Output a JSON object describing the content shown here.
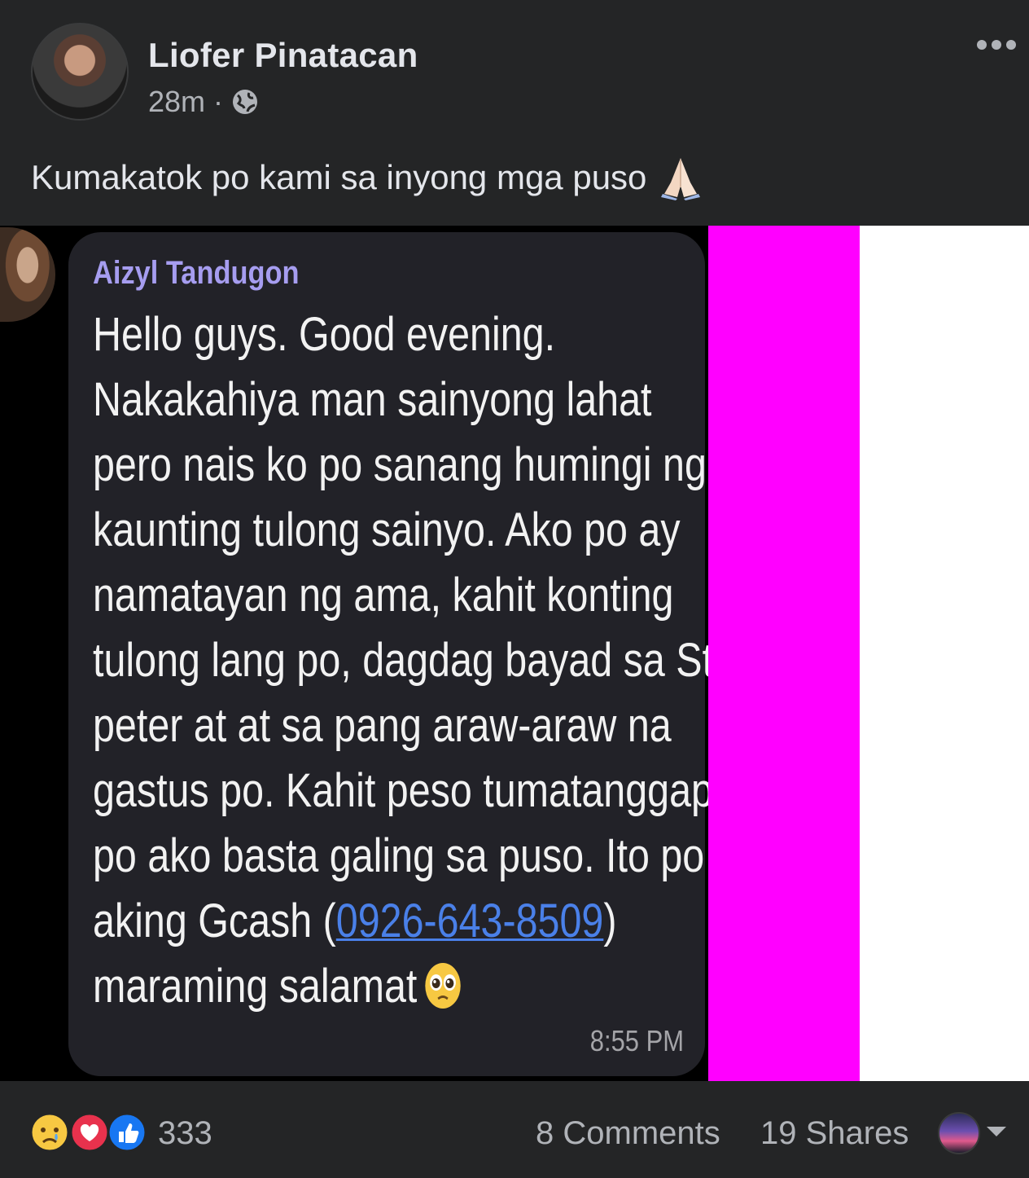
{
  "post": {
    "author": "Liofer Pinatacan",
    "time": "28m",
    "separator": "·",
    "privacy_icon": "globe-icon",
    "more_icon": "more-options-icon",
    "caption": "Kumakatok po kami sa inyong mga puso",
    "caption_emoji": "folded-hands-icon"
  },
  "message": {
    "sender": "Aizyl Tandugon",
    "lines": [
      "Hello guys. Good evening.",
      "Nakakahiya man sainyong lahat",
      "pero nais ko po sanang humingi ng",
      "kaunting tulong sainyo. Ako po ay",
      "namatayan ng ama, kahit konting",
      "tulong lang po, dagdag bayad sa St.",
      "peter at at sa pang araw-araw na",
      "gastus po. Kahit peso tumatanggap",
      "po ako basta galing sa puso. Ito po"
    ],
    "gcash_prefix": "aking Gcash (",
    "phone": "0926-643-8509",
    "gcash_suffix": ")",
    "last_line": "maraming salamat",
    "last_emoji": "pleading-face-icon",
    "time": "8:55 PM"
  },
  "footer": {
    "reactions": [
      "sad-reaction-icon",
      "love-reaction-icon",
      "like-reaction-icon"
    ],
    "reaction_count": "333",
    "comments": "8 Comments",
    "shares": "19 Shares"
  },
  "colors": {
    "background": "#242526",
    "sender_name": "#a69df0",
    "link": "#4a80e8",
    "magenta": "#ff00ff"
  }
}
